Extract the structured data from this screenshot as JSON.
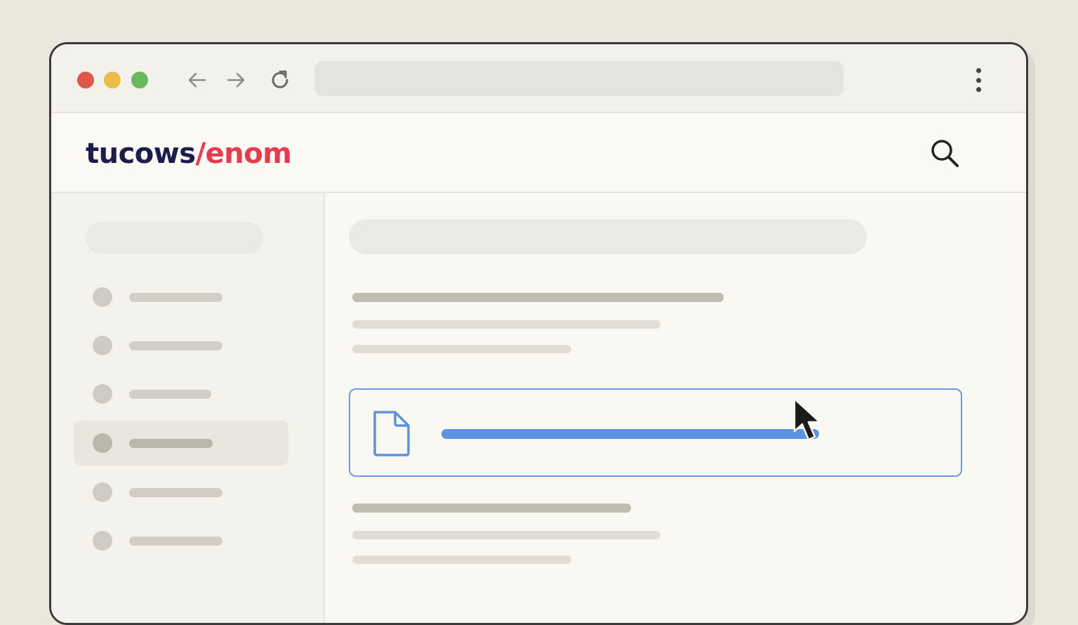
{
  "browser": {
    "traffic_lights": {
      "close_color": "#e0564b",
      "minimize_color": "#ecbb48",
      "maximize_color": "#69b95c"
    },
    "nav": {
      "back_icon": "arrow-left-icon",
      "forward_icon": "arrow-right-icon",
      "reload_icon": "reload-icon"
    },
    "address_bar": {
      "value": ""
    },
    "menu_icon": "kebab-menu-icon"
  },
  "header": {
    "logo": {
      "part1": "tucows",
      "separator": "/",
      "part2": "enom",
      "part1_color": "#1b1d4a",
      "part2_color": "#e8394d"
    },
    "search_icon": "search-icon"
  },
  "sidebar": {
    "items": [
      {
        "active": false
      },
      {
        "active": false
      },
      {
        "active": false
      },
      {
        "active": true
      },
      {
        "active": false
      },
      {
        "active": false
      }
    ]
  },
  "main": {
    "file_row": {
      "icon": "document-icon",
      "accent_color": "#5b92e2",
      "highlighted": true
    }
  },
  "cursor": {
    "icon": "mouse-pointer-icon"
  }
}
